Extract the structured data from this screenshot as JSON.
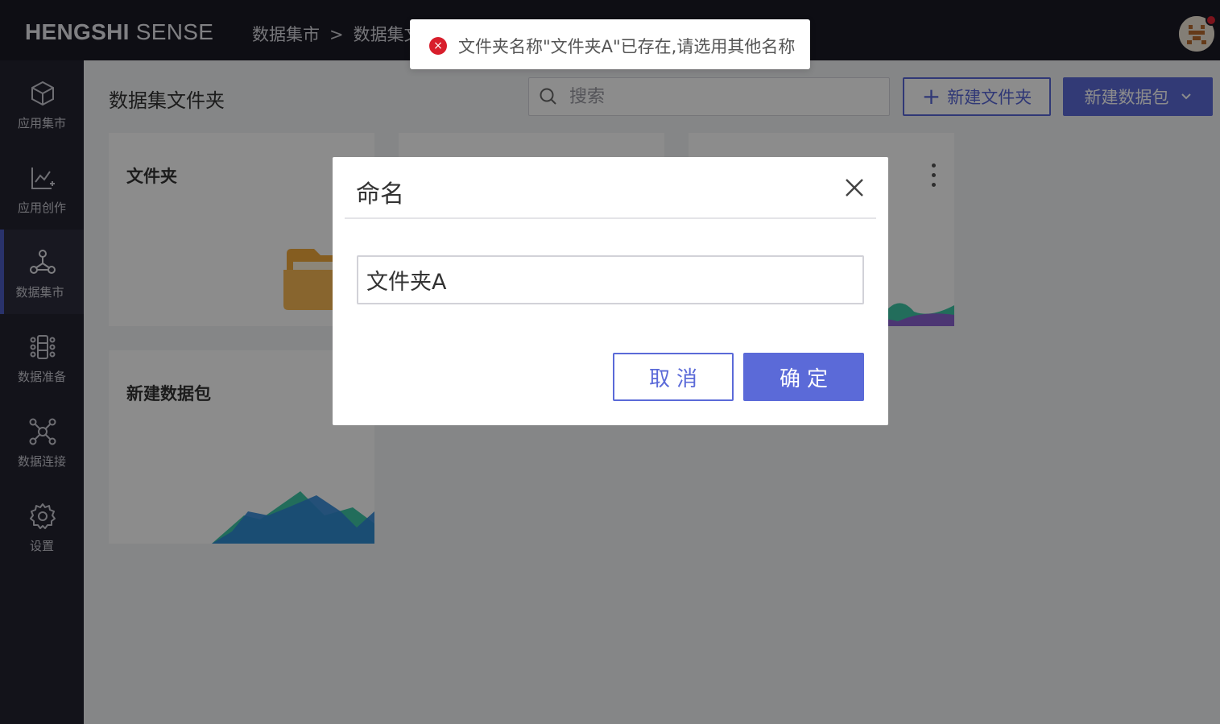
{
  "header": {
    "logo_bold": "HENGSHI",
    "logo_light": "SENSE",
    "breadcrumb": [
      "数据集市",
      "数据集文件夹"
    ],
    "breadcrumb_sep": ">"
  },
  "sidebar": {
    "items": [
      {
        "label": "应用集市",
        "icon": "cube-icon",
        "active": false
      },
      {
        "label": "应用创作",
        "icon": "chart-edit-icon",
        "active": false
      },
      {
        "label": "数据集市",
        "icon": "hub-icon",
        "active": true
      },
      {
        "label": "数据准备",
        "icon": "data-prep-icon",
        "active": false
      },
      {
        "label": "数据连接",
        "icon": "network-icon",
        "active": false
      },
      {
        "label": "设置",
        "icon": "gear-icon",
        "active": false
      }
    ]
  },
  "main": {
    "title": "数据集文件夹",
    "search_placeholder": "搜索",
    "new_folder_label": "新建文件夹",
    "new_package_label": "新建数据包",
    "cards": [
      {
        "title": "文件夹",
        "type": "folder"
      },
      {
        "title": "",
        "type": "blank"
      },
      {
        "title": "",
        "type": "chart"
      },
      {
        "title": "新建数据包",
        "type": "new-package"
      }
    ]
  },
  "dialog": {
    "title": "命名",
    "input_value": "文件夹A",
    "cancel_label": "取消",
    "ok_label": "确定"
  },
  "toast": {
    "message": "文件夹名称\"文件夹A\"已存在,请选用其他名称",
    "type": "error"
  },
  "colors": {
    "accent": "#5b6ad8",
    "topbar": "#1b1b26",
    "sidebar": "#232330",
    "error": "#d81e2c"
  }
}
